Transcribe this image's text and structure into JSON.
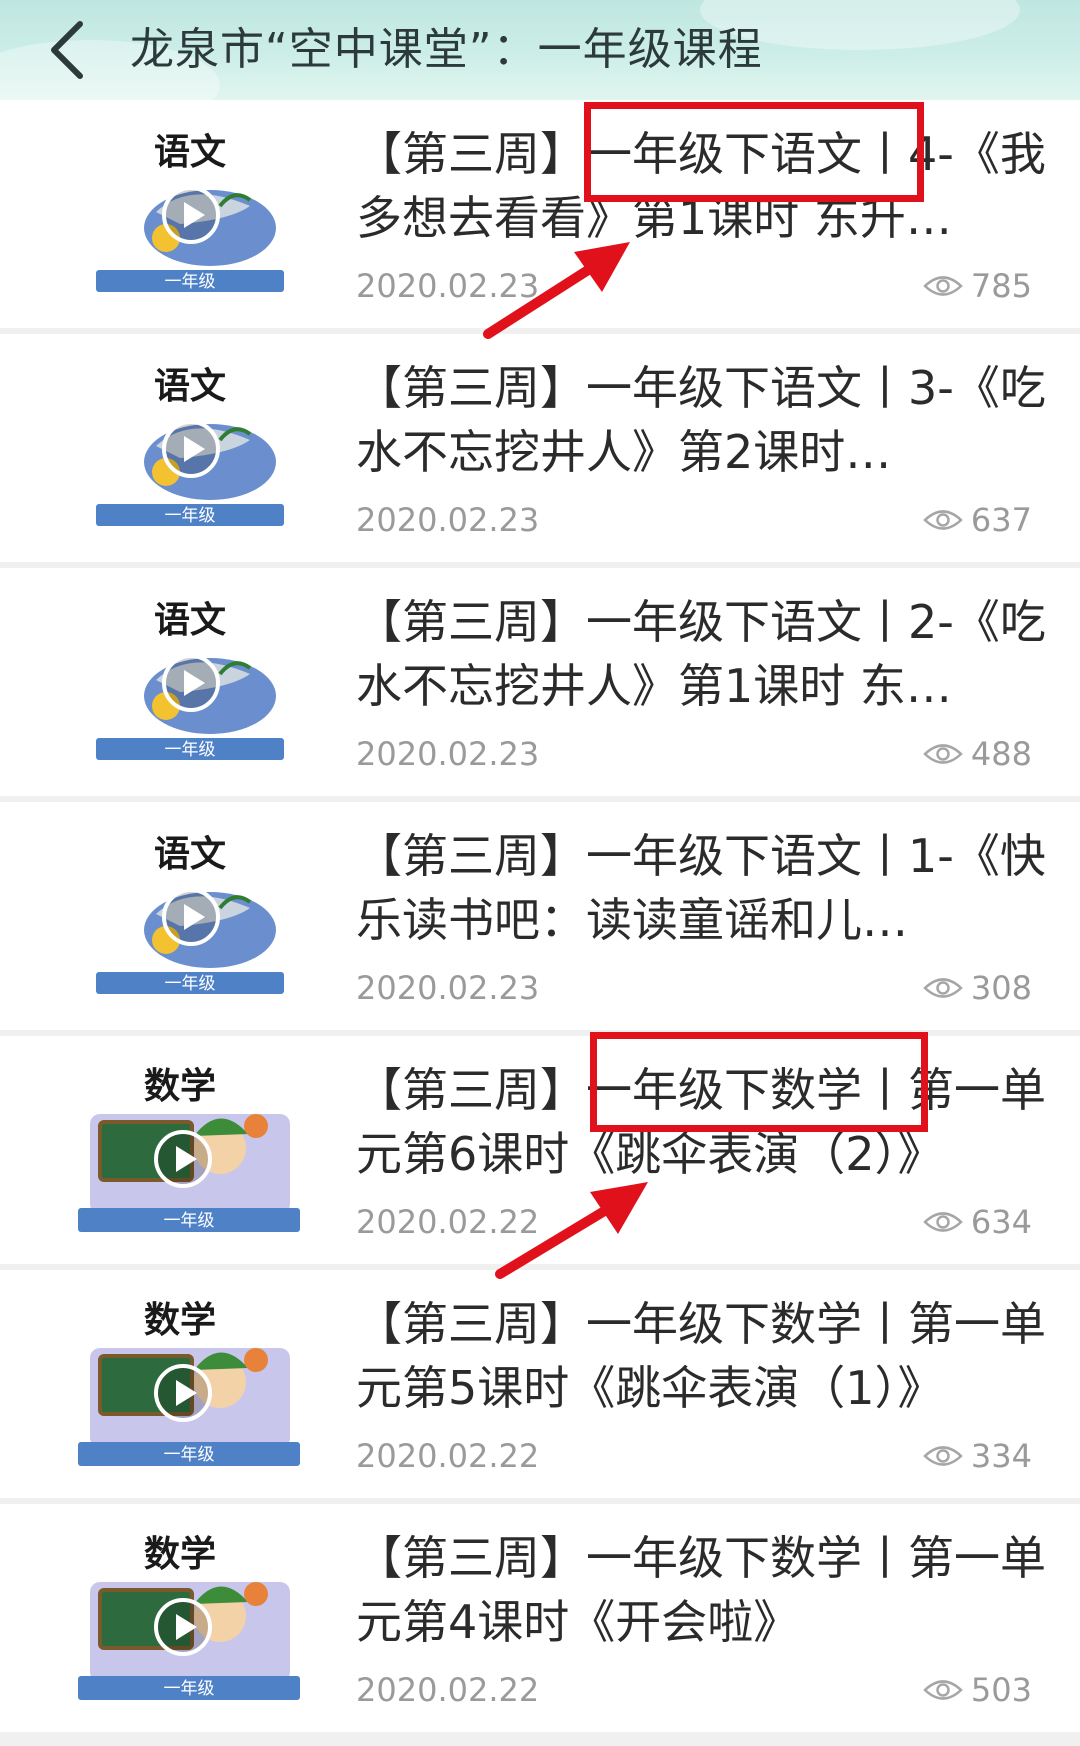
{
  "header": {
    "title": "龙泉市“空中课堂”：一年级课程",
    "back_icon": "chevron-left-icon"
  },
  "colors": {
    "annotation_red": "#e1111b",
    "meta_gray": "#9a9a9a"
  },
  "items": [
    {
      "subject": "语文",
      "grade_label": "一年级",
      "title": "【第三周】一年级下语文丨4-《我多想去看看》第1课时 东升…",
      "date": "2020.02.23",
      "views": "785"
    },
    {
      "subject": "语文",
      "grade_label": "一年级",
      "title": "【第三周】一年级下语文丨3-《吃水不忘挖井人》第2课时…",
      "date": "2020.02.23",
      "views": "637"
    },
    {
      "subject": "语文",
      "grade_label": "一年级",
      "title": "【第三周】一年级下语文丨2-《吃水不忘挖井人》第1课时 东…",
      "date": "2020.02.23",
      "views": "488"
    },
    {
      "subject": "语文",
      "grade_label": "一年级",
      "title": "【第三周】一年级下语文丨1-《快乐读书吧：读读童谣和儿…",
      "date": "2020.02.23",
      "views": "308"
    },
    {
      "subject": "数学",
      "grade_label": "一年级",
      "title": "【第三周】一年级下数学丨第一单元第6课时《跳伞表演（2）》",
      "date": "2020.02.22",
      "views": "634"
    },
    {
      "subject": "数学",
      "grade_label": "一年级",
      "title": "【第三周】一年级下数学丨第一单元第5课时《跳伞表演（1）》",
      "date": "2020.02.22",
      "views": "334"
    },
    {
      "subject": "数学",
      "grade_label": "一年级",
      "title": "【第三周】一年级下数学丨第一单元第4课时《开会啦》",
      "date": "2020.02.22",
      "views": "503"
    }
  ]
}
